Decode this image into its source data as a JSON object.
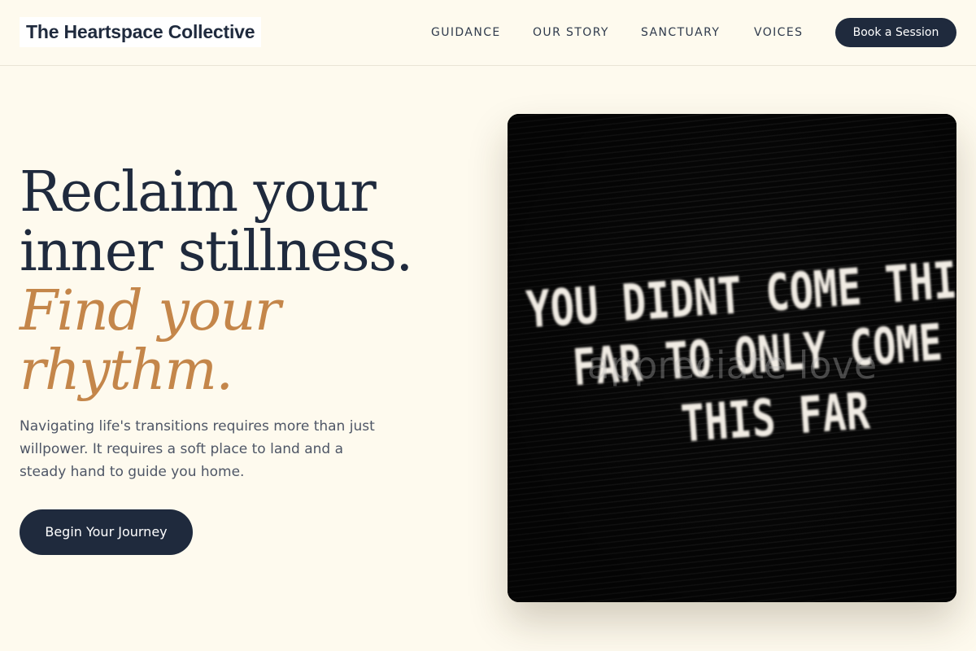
{
  "header": {
    "brand": "The Heartspace Collective",
    "nav": [
      "GUIDANCE",
      "OUR STORY",
      "SANCTUARY",
      "VOICES"
    ],
    "cta_label": "Book a Session"
  },
  "hero": {
    "headline_line1": "Reclaim your",
    "headline_line2": "inner stillness.",
    "accent_line1": "Find your",
    "accent_line2": "rhythm.",
    "lead": "Navigating life's transitions requires more than just willpower. It requires a soft place to land and a steady hand to guide you home.",
    "cta_label": "Begin Your Journey"
  },
  "image": {
    "board_lines": [
      "YOU DIDNT COME THIS",
      "FAR TO ONLY COME",
      "THIS FAR"
    ],
    "overlay_text": "appreciate love"
  },
  "colors": {
    "background": "#fefaee",
    "navy": "#1f2a3d",
    "accent": "#c4864a"
  }
}
